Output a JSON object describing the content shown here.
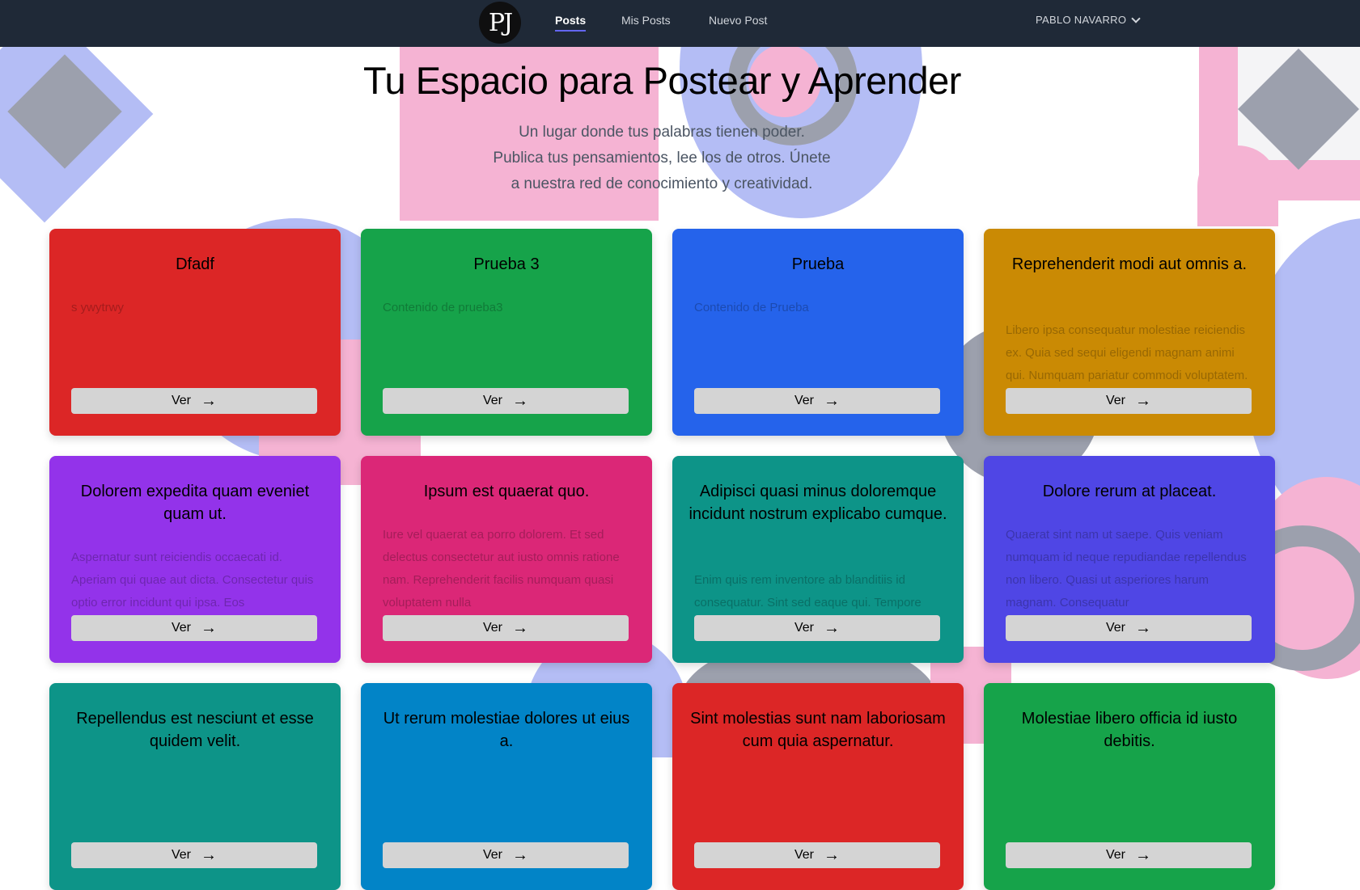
{
  "nav": {
    "logo_text": "PJ",
    "links": [
      {
        "label": "Posts",
        "active": true
      },
      {
        "label": "Mis Posts",
        "active": false
      },
      {
        "label": "Nuevo Post",
        "active": false
      }
    ],
    "user_name": "PABLO NAVARRO",
    "user_icon": "chevron-down-icon"
  },
  "hero": {
    "title": "Tu Espacio para Postear y Aprender",
    "subtitle_lines": [
      "Un lugar donde tus palabras tienen poder.",
      "Publica tus pensamientos, lee los de otros. Únete",
      "a nuestra red de conocimiento y creatividad."
    ]
  },
  "button_label": "Ver",
  "button_icon": "arrow-right-icon",
  "posts": [
    {
      "title": "Dfadf",
      "body": "s ywytrwy",
      "color": "#dc2626"
    },
    {
      "title": "Prueba 3",
      "body": "Contenido de prueba3",
      "color": "#16a34a"
    },
    {
      "title": "Prueba",
      "body": "Contenido de Prueba",
      "color": "#2563eb"
    },
    {
      "title": "Reprehenderit modi aut omnis a.",
      "body": "Libero ipsa consequatur molestiae reiciendis ex. Quia sed sequi eligendi magnam animi qui. Numquam pariatur commodi voluptatem. Adipisci aperiam",
      "color": "#ca8a04"
    },
    {
      "title": "Dolorem expedita quam eveniet quam ut.",
      "body": "Aspernatur sunt reiciendis occaecati id. Aperiam qui quae aut dicta. Consectetur quis optio error incidunt qui ipsa. Eos",
      "color": "#9333ea"
    },
    {
      "title": "Ipsum est quaerat quo.",
      "body": "Iure vel quaerat ea porro dolorem. Et sed delectus consectetur aut iusto omnis ratione nam. Reprehenderit facilis numquam quasi voluptatem nulla",
      "color": "#db2777"
    },
    {
      "title": "Adipisci quasi minus doloremque incidunt nostrum explicabo cumque.",
      "body": "Enim quis rem inventore ab blanditiis id consequatur. Sint sed eaque qui. Tempore",
      "color": "#0d9488"
    },
    {
      "title": "Dolore rerum at placeat.",
      "body": "Quaerat sint nam ut saepe. Quis veniam numquam id neque repudiandae repellendus non libero. Quasi ut asperiores harum magnam. Consequatur",
      "color": "#4f46e5"
    },
    {
      "title": "Repellendus est nesciunt et esse quidem velit.",
      "body": "",
      "color": "#0d9488"
    },
    {
      "title": "Ut rerum molestiae dolores ut eius a.",
      "body": "",
      "color": "#0284c7"
    },
    {
      "title": "Sint molestias sunt nam laboriosam cum quia aspernatur.",
      "body": "",
      "color": "#dc2626"
    },
    {
      "title": "Molestiae libero officia id iusto debitis.",
      "body": "",
      "color": "#16a34a"
    }
  ]
}
